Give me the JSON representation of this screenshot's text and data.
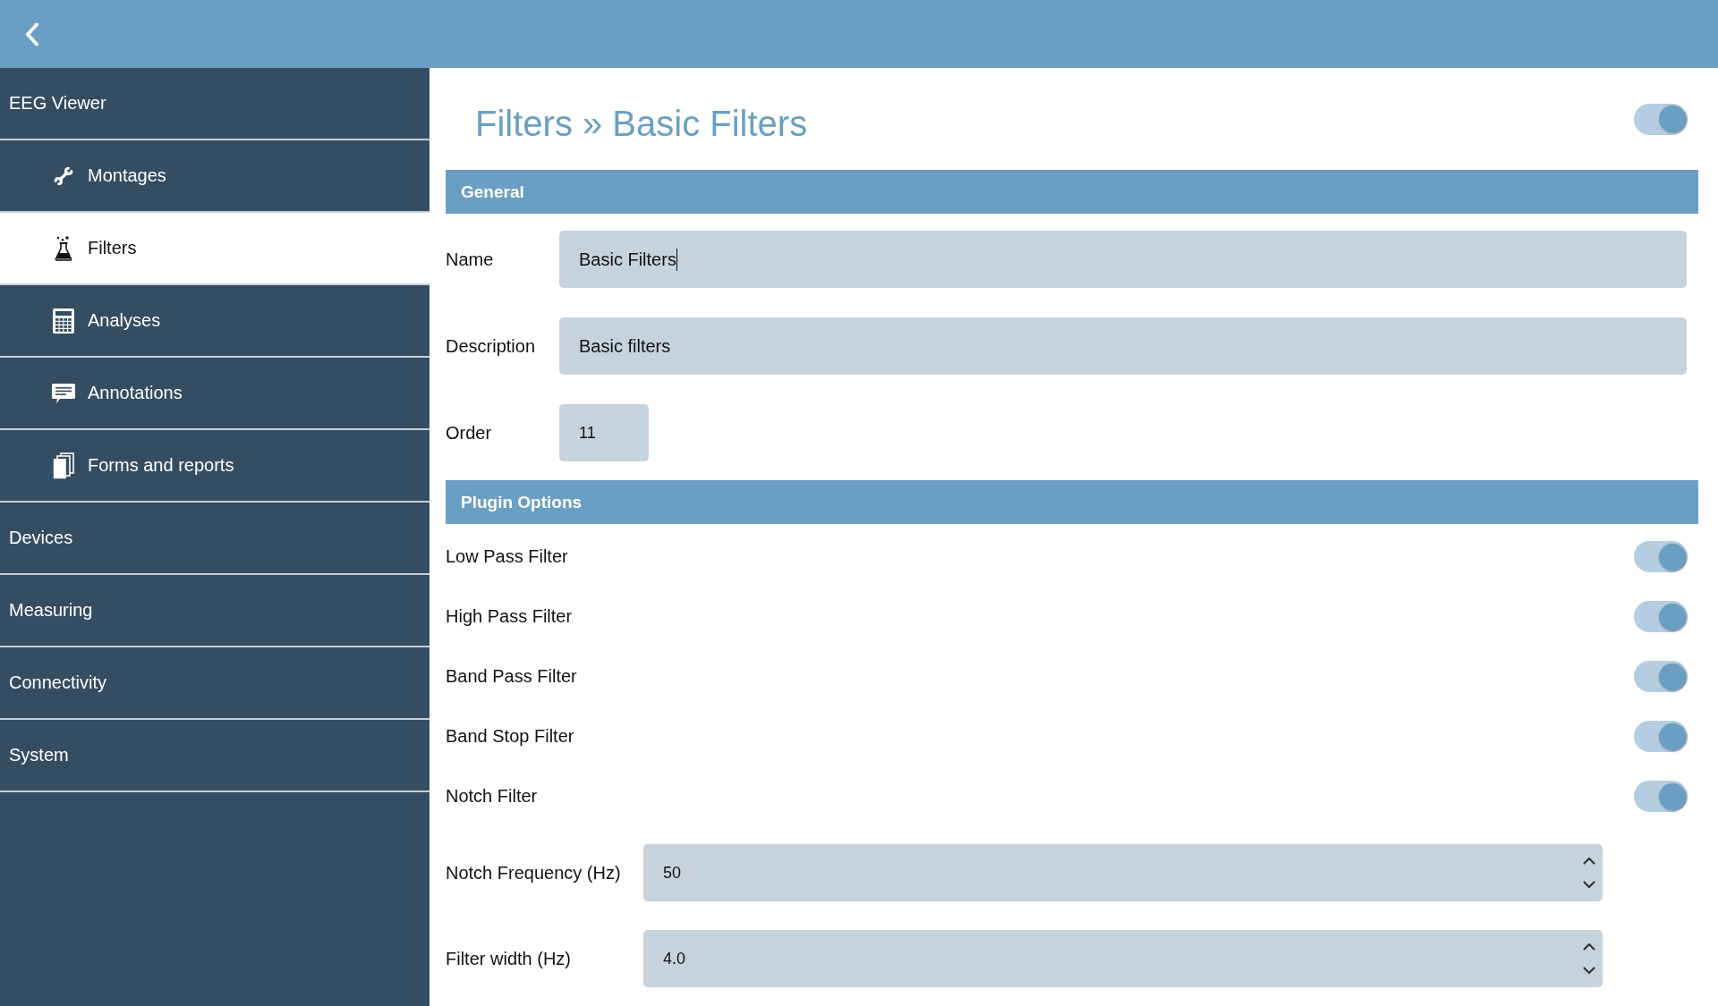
{
  "sidebar": {
    "items": [
      {
        "label": "EEG Viewer",
        "selected": false,
        "children": [
          {
            "label": "Montages",
            "selected": false
          },
          {
            "label": "Filters",
            "selected": true
          },
          {
            "label": "Analyses",
            "selected": false
          },
          {
            "label": "Annotations",
            "selected": false
          },
          {
            "label": "Forms and reports",
            "selected": false
          }
        ]
      },
      {
        "label": "Devices",
        "selected": false
      },
      {
        "label": "Measuring",
        "selected": false
      },
      {
        "label": "Connectivity",
        "selected": false
      },
      {
        "label": "System",
        "selected": false
      }
    ]
  },
  "page": {
    "title": "Filters » Basic Filters",
    "enabled_toggle": {
      "on": true
    }
  },
  "sections": [
    {
      "title": "General",
      "fields": [
        {
          "kind": "text",
          "label": "Name",
          "value": "Basic Filters",
          "focused": true
        },
        {
          "kind": "text",
          "label": "Description",
          "value": "Basic filters",
          "focused": false
        },
        {
          "kind": "short",
          "label": "Order",
          "value": "11",
          "focused": false
        }
      ]
    },
    {
      "title": "Plugin Options",
      "fields": [
        {
          "kind": "toggle",
          "label": "Low Pass Filter",
          "on": true
        },
        {
          "kind": "toggle",
          "label": "High Pass Filter",
          "on": true
        },
        {
          "kind": "toggle",
          "label": "Band Pass Filter",
          "on": true
        },
        {
          "kind": "toggle",
          "label": "Band Stop Filter",
          "on": true
        },
        {
          "kind": "toggle",
          "label": "Notch Filter",
          "on": true
        },
        {
          "kind": "spinner",
          "label": "Notch Frequency (Hz)",
          "value": "50",
          "focused": false
        },
        {
          "kind": "spinner",
          "label": "Filter width (Hz)",
          "value": "4.0",
          "focused": false
        }
      ]
    }
  ]
}
